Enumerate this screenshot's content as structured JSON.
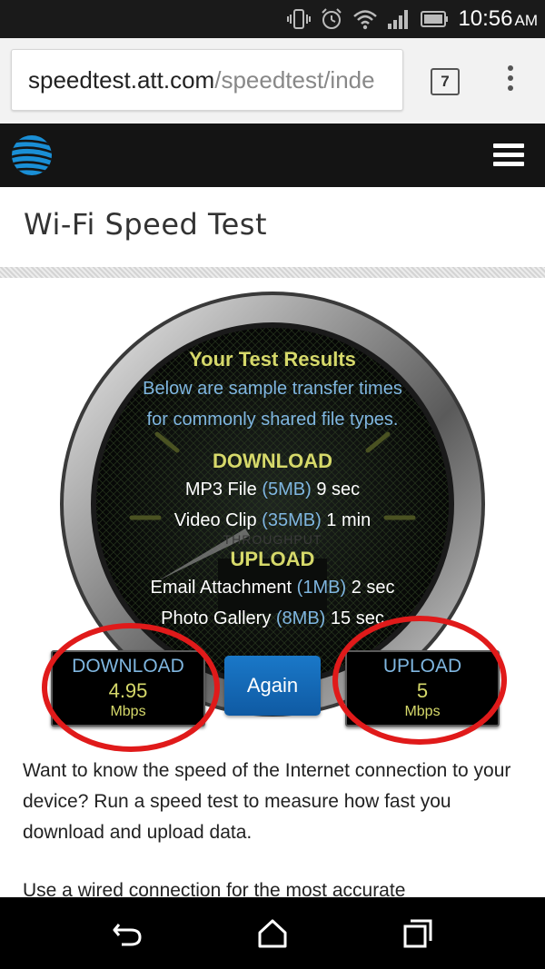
{
  "status_bar": {
    "time": "10:56",
    "ampm": "AM",
    "icons": [
      "vibrate-icon",
      "alarm-icon",
      "wifi-icon",
      "signal-icon",
      "battery-icon"
    ]
  },
  "browser": {
    "url_host": "speedtest.att.com",
    "url_path": "/speedtest/inde",
    "tab_count": "7"
  },
  "header": {
    "logo": "att-globe-icon",
    "menu_icon": "hamburger-menu-icon",
    "brand_color": "#1a8fd6"
  },
  "page": {
    "title": "Wi-Fi Speed Test"
  },
  "results": {
    "heading": "Your Test Results",
    "sub_line1": "Below are sample transfer times",
    "sub_line2": "for commonly shared file types.",
    "download_heading": "DOWNLOAD",
    "download_rows": [
      {
        "name": "MP3 File",
        "size": "(5MB)",
        "time": "9 sec"
      },
      {
        "name": "Video Clip",
        "size": "(35MB)",
        "time": "1 min"
      }
    ],
    "faint_label": "THROUGHPUT",
    "upload_heading": "UPLOAD",
    "upload_rows": [
      {
        "name": "Email Attachment",
        "size": "(1MB)",
        "time": "2 sec"
      },
      {
        "name": "Photo Gallery",
        "size": "(8MB)",
        "time": "15 sec"
      }
    ]
  },
  "speeds": {
    "download": {
      "label": "DOWNLOAD",
      "value": "4.95",
      "unit": "Mbps"
    },
    "upload": {
      "label": "UPLOAD",
      "value": "5",
      "unit": "Mbps"
    },
    "again_label": "Again"
  },
  "description": {
    "para1": "Want to know the speed of the Internet connection to your device? Run a speed test to measure how fast you download and upload data.",
    "para2": "Use a wired connection for the most accurate"
  },
  "nav_bar": {
    "icons": [
      "back-icon",
      "home-icon",
      "recent-apps-icon"
    ]
  },
  "colors": {
    "accent_yellow": "#d6d96a",
    "accent_blue": "#7fb6e0",
    "button_blue": "#1a78c8",
    "annotation_red": "#e01a1a"
  }
}
